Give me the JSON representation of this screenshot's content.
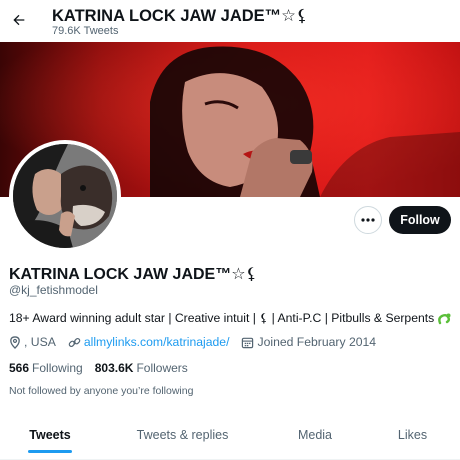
{
  "header": {
    "title": "KATRINA LOCK JAW JADE™☆⚸",
    "tweets_count": "79.6K Tweets"
  },
  "profile": {
    "display_name": "KATRINA LOCK JAW JADE™☆⚸",
    "handle": "@kj_fetishmodel",
    "bio": "18+ Award winning adult star | Creative intuit | ⚸ | Anti-P.C | Pitbulls & Serpents",
    "location": ", USA",
    "website": "allmylinks.com/katrinajade/",
    "joined": "Joined February 2014",
    "following_count": "566",
    "following_label": "Following",
    "followers_count": "803.6K",
    "followers_label": "Followers",
    "not_followed_note": "Not followed by anyone you’re following"
  },
  "actions": {
    "follow_label": "Follow"
  },
  "tabs": [
    {
      "label": "Tweets",
      "active": true
    },
    {
      "label": "Tweets & replies",
      "active": false
    },
    {
      "label": "Media",
      "active": false
    },
    {
      "label": "Likes",
      "active": false
    }
  ],
  "icons": {
    "back": "arrow-left-icon",
    "more": "more-dots-icon",
    "bio_emoji": "snake-icon",
    "location": "location-pin-icon",
    "website": "link-icon",
    "calendar": "calendar-icon"
  },
  "colors": {
    "accent": "#1d9bf0",
    "follow_bg": "#0f1419",
    "banner": "#d31616",
    "snake": "#5bbf3a"
  }
}
